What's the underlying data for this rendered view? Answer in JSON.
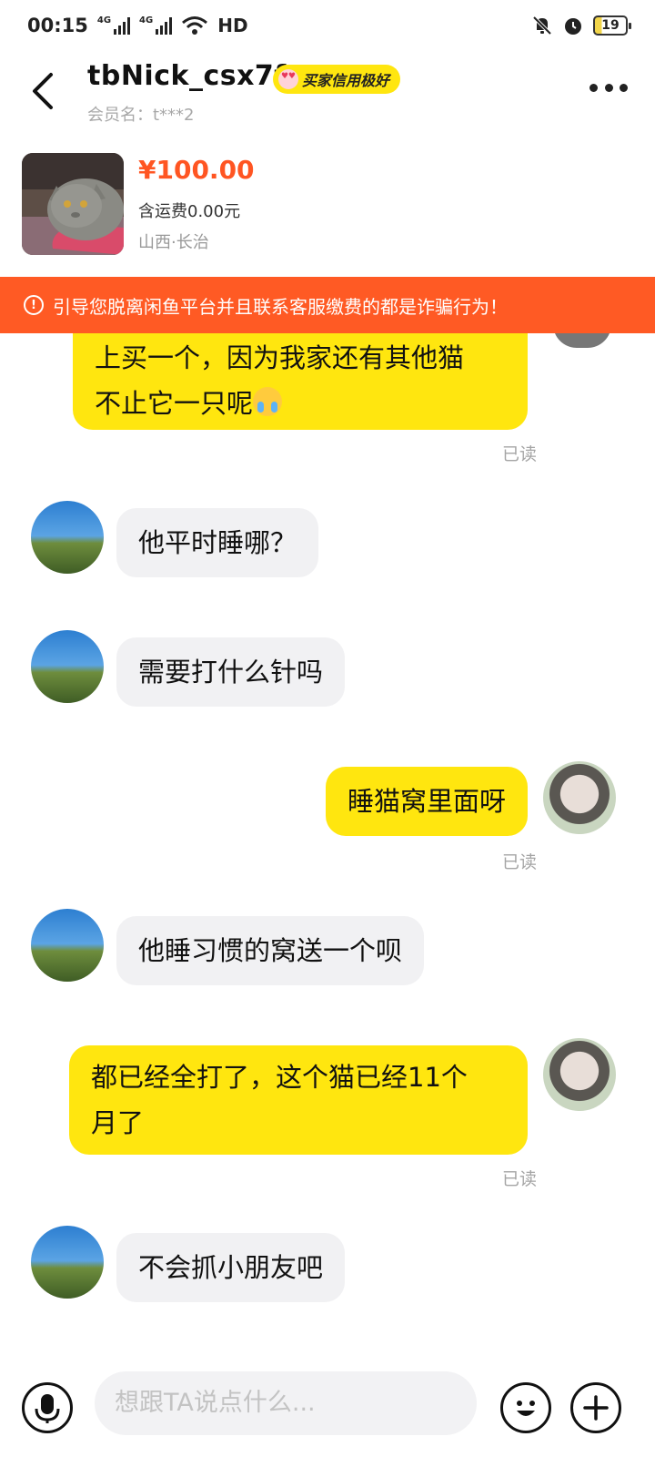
{
  "status_bar": {
    "time": "00:15",
    "signal1_label": "4G",
    "signal2_label": "4G",
    "hd_label": "HD",
    "battery": "19"
  },
  "header": {
    "nickname": "tbNick_csx7f",
    "credit_badge": "买家信用极好",
    "member_label": "会员名：t***2"
  },
  "product": {
    "price": "¥100.00",
    "shipping": "含运费0.00元",
    "location": "山西·长治"
  },
  "warning": {
    "text": "引导您脱离闲鱼平台并且联系客服缴费的都是诈骗行为！"
  },
  "messages": [
    {
      "from": "me",
      "line1": "上买一个，因为我家还有其他猫",
      "line2": "不止它一只呢",
      "status": "已读"
    },
    {
      "from": "them",
      "text": "他平时睡哪？"
    },
    {
      "from": "them",
      "text": "需要打什么针吗"
    },
    {
      "from": "me",
      "text": "睡猫窝里面呀",
      "status": "已读"
    },
    {
      "from": "them",
      "text": "他睡习惯的窝送一个呗"
    },
    {
      "from": "me",
      "line1": "都已经全打了，这个猫已经11个",
      "line2": "月了",
      "status": "已读"
    },
    {
      "from": "them",
      "text": "不会抓小朋友吧"
    }
  ],
  "input": {
    "placeholder": "想跟TA说点什么..."
  },
  "icons": {
    "back": "chevron-left-icon",
    "more": "more-icon",
    "mic": "microphone-icon",
    "emoji": "smiley-icon",
    "plus": "plus-icon"
  },
  "colors": {
    "accent_yellow": "#ffe60f",
    "price_orange": "#ff5522",
    "warning_bg": "#ff5a24",
    "incoming_bubble": "#f1f1f3"
  }
}
